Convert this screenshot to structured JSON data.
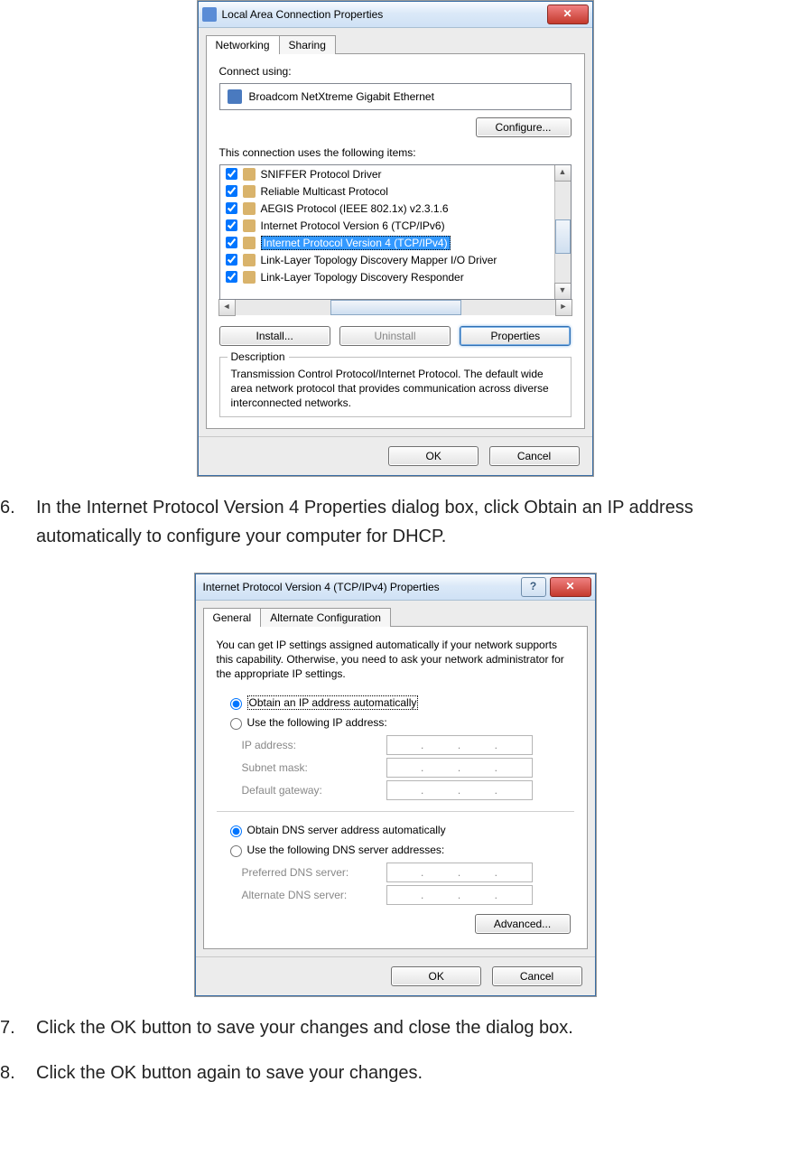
{
  "dialog1": {
    "title": "Local Area Connection Properties",
    "tabs": {
      "networking": "Networking",
      "sharing": "Sharing"
    },
    "connect_using_label": "Connect using:",
    "adapter": "Broadcom NetXtreme Gigabit Ethernet",
    "configure_btn": "Configure...",
    "items_label": "This connection uses the following items:",
    "items": [
      "SNIFFER Protocol Driver",
      "Reliable Multicast Protocol",
      "AEGIS Protocol (IEEE 802.1x) v2.3.1.6",
      "Internet Protocol Version 6 (TCP/IPv6)",
      "Internet Protocol Version 4 (TCP/IPv4)",
      "Link-Layer Topology Discovery Mapper I/O Driver",
      "Link-Layer Topology Discovery Responder"
    ],
    "install_btn": "Install...",
    "uninstall_btn": "Uninstall",
    "properties_btn": "Properties",
    "description_label": "Description",
    "description_text": "Transmission Control Protocol/Internet Protocol. The default wide area network protocol that provides communication across diverse interconnected networks.",
    "ok_btn": "OK",
    "cancel_btn": "Cancel"
  },
  "step6": {
    "num": "6.",
    "text": "In the Internet Protocol Version 4 Properties dialog box, click Obtain an IP address automatically to configure your computer for DHCP."
  },
  "dialog2": {
    "title": "Internet Protocol Version 4 (TCP/IPv4) Properties",
    "tabs": {
      "general": "General",
      "alt": "Alternate Configuration"
    },
    "intro": "You can get IP settings assigned automatically if your network supports this capability. Otherwise, you need to ask your network administrator for the appropriate IP settings.",
    "r_obtain_ip": "Obtain an IP address automatically",
    "r_use_ip": "Use the following IP address:",
    "f_ip": "IP address:",
    "f_subnet": "Subnet mask:",
    "f_gateway": "Default gateway:",
    "r_obtain_dns": "Obtain DNS server address automatically",
    "r_use_dns": "Use the following DNS server addresses:",
    "f_pref_dns": "Preferred DNS server:",
    "f_alt_dns": "Alternate DNS server:",
    "advanced_btn": "Advanced...",
    "ok_btn": "OK",
    "cancel_btn": "Cancel"
  },
  "step7": {
    "num": "7.",
    "text": "Click the OK button to save your changes and close the dialog box."
  },
  "step8": {
    "num": "8.",
    "text": "Click the OK button again to save your changes."
  }
}
